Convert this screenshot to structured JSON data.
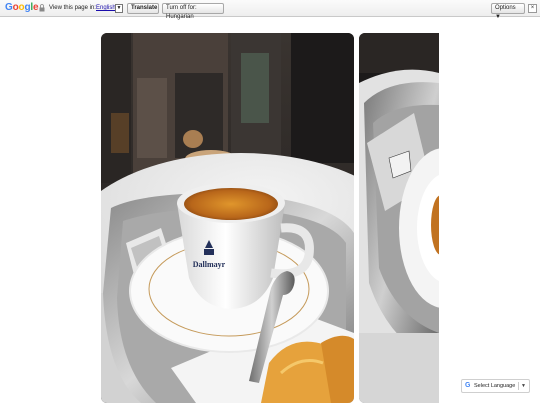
{
  "translate_bar": {
    "logo": "Google",
    "view_label": "View this page in:",
    "selected_language": "English",
    "dropdown_arrow": "▼",
    "translate_button": "Translate",
    "turn_off_button": "Turn off for: Hungarian",
    "options_button": "Options ▼",
    "close_symbol": "×"
  },
  "gallery": {
    "main_photo_logo": "Dallmayr"
  },
  "language_widget": {
    "logo": "G",
    "label": "Select Language",
    "arrow": "▼"
  },
  "colors": {
    "bar_bg": "#eeeeee",
    "link": "#1a0dab",
    "google_blue": "#4285f4",
    "google_red": "#ea4335",
    "google_yellow": "#fbbc05",
    "google_green": "#34a853"
  }
}
